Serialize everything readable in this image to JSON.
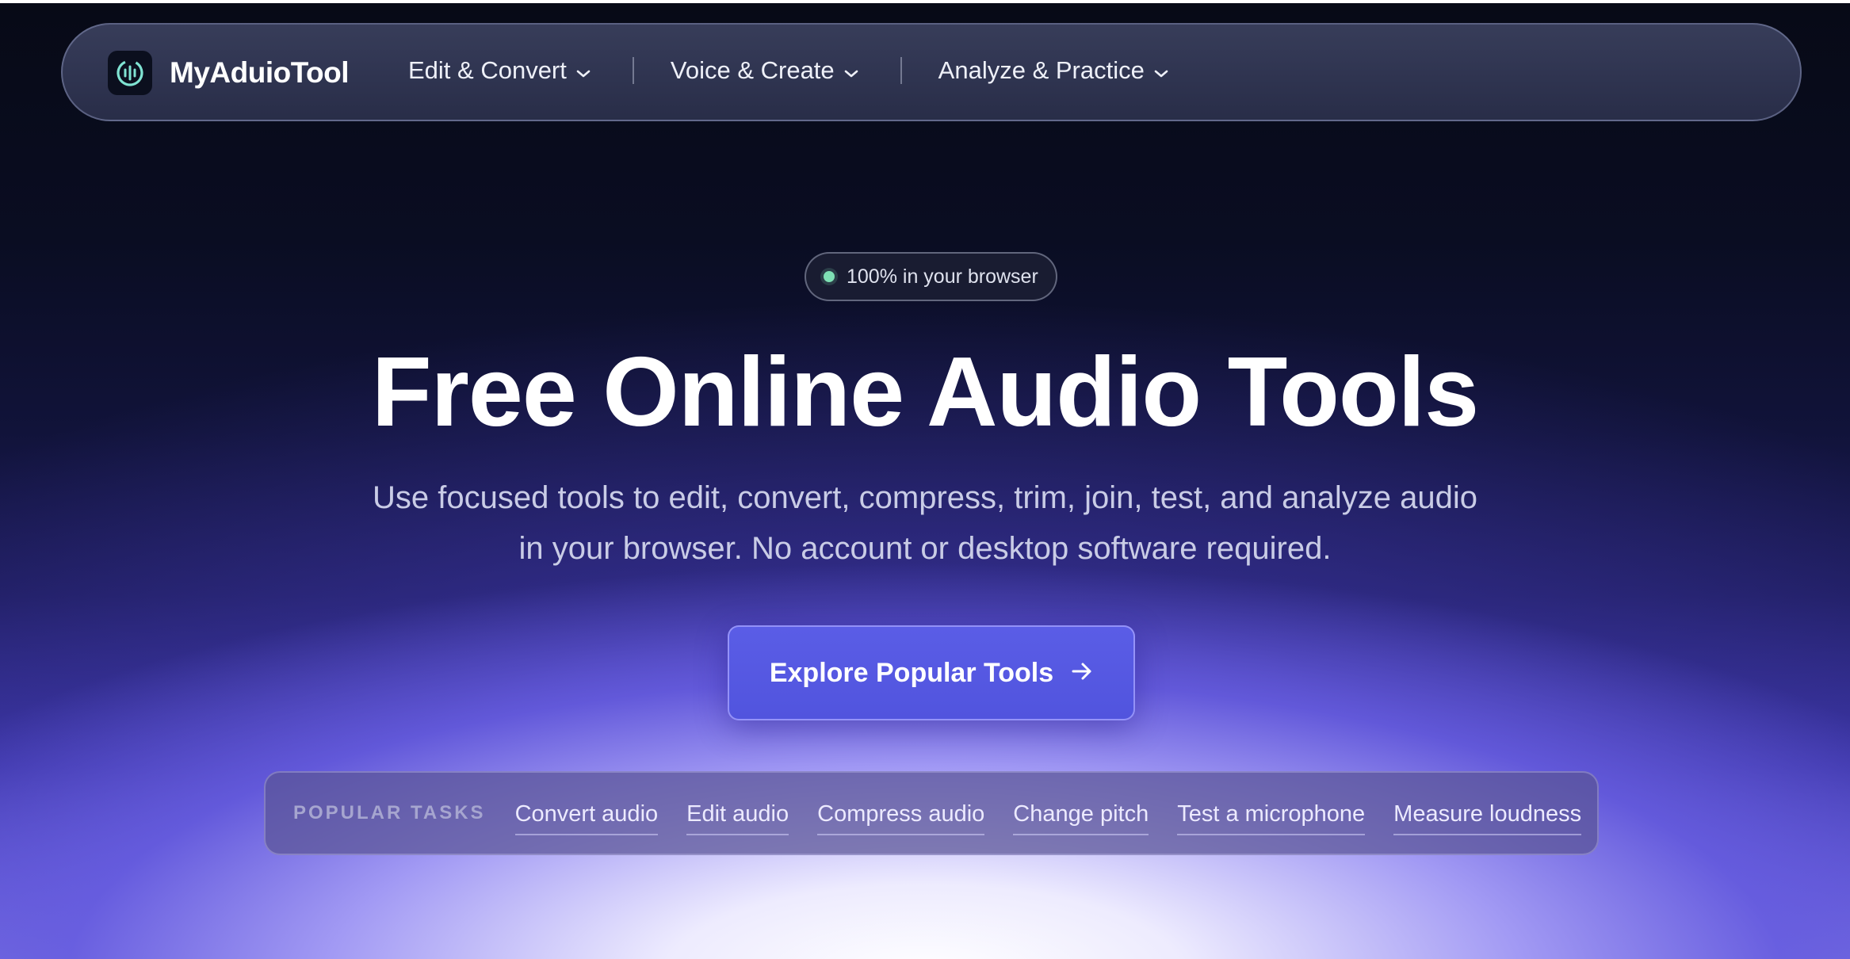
{
  "brand": {
    "name": "MyAduioTool",
    "logo_icon": "audio-waveform-icon"
  },
  "nav": {
    "items": [
      {
        "label": "Edit & Convert",
        "icon": "chevron-down-icon"
      },
      {
        "label": "Voice & Create",
        "icon": "chevron-down-icon"
      },
      {
        "label": "Analyze & Practice",
        "icon": "chevron-down-icon"
      }
    ]
  },
  "hero": {
    "badge": "100% in your browser",
    "title": "Free Online Audio Tools",
    "subtitle": "Use focused tools to edit, convert, compress, trim, join, test, and analyze audio in your browser. No account or desktop software required.",
    "cta_label": "Explore Popular Tools",
    "cta_icon": "arrow-right-icon"
  },
  "popular_tasks": {
    "label": "POPULAR TASKS",
    "links": [
      "Convert audio",
      "Edit audio",
      "Compress audio",
      "Change pitch",
      "Test a microphone",
      "Measure loudness"
    ]
  },
  "colors": {
    "accent": "#5154de",
    "status_dot": "#7ee0b4",
    "logo_teal": "#7fe3d2"
  }
}
